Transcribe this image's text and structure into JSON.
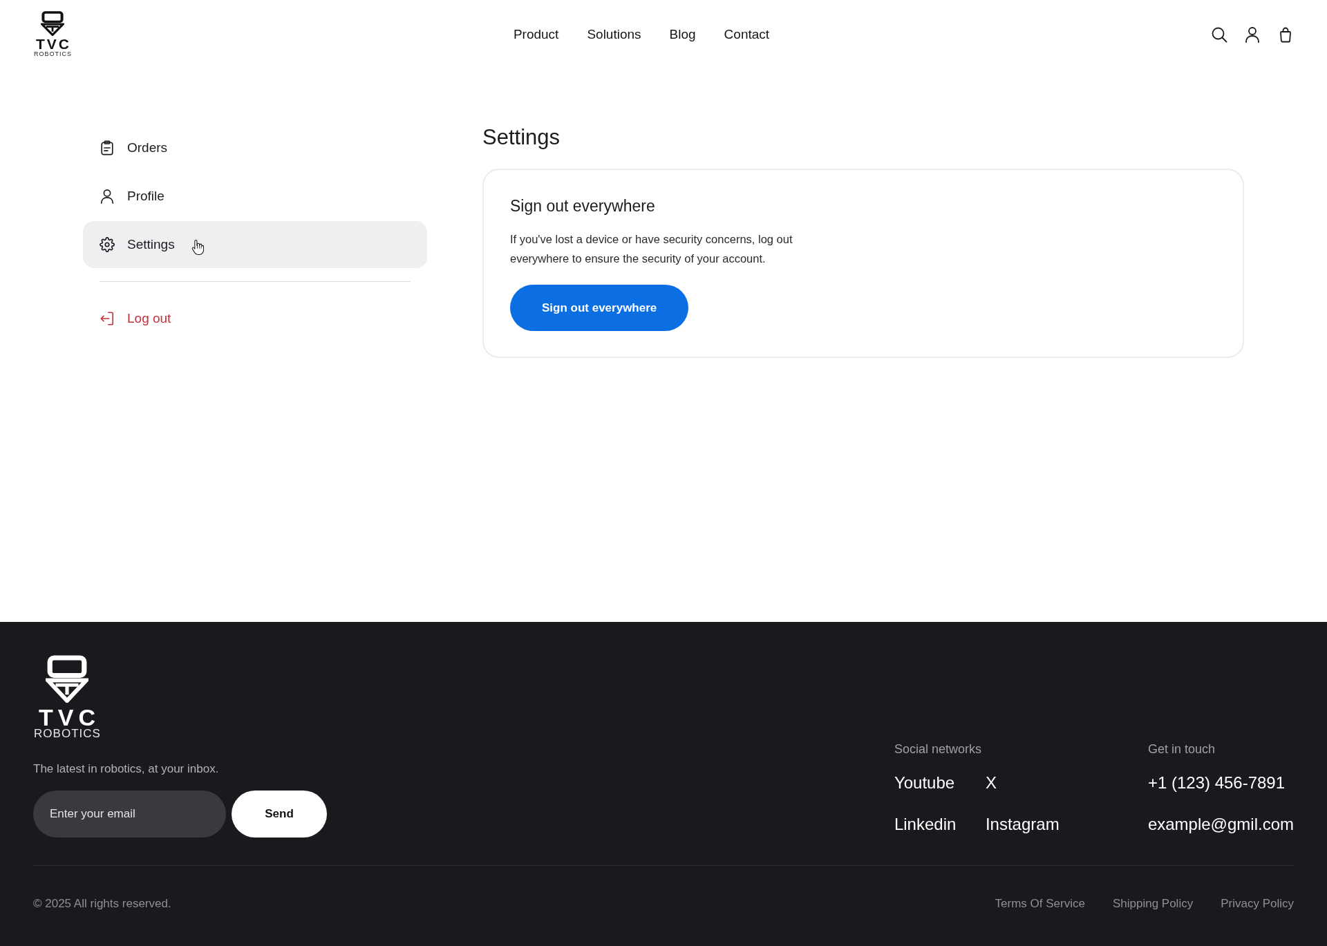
{
  "header": {
    "logo": {
      "name": "TVC",
      "subtitle": "ROBOTICS"
    },
    "nav": [
      "Product",
      "Solutions",
      "Blog",
      "Contact"
    ]
  },
  "sidebar": {
    "items": [
      {
        "label": "Orders",
        "selected": false
      },
      {
        "label": "Profile",
        "selected": false
      },
      {
        "label": "Settings",
        "selected": true
      }
    ],
    "logout": {
      "label": "Log out"
    }
  },
  "page": {
    "title": "Settings",
    "card": {
      "title": "Sign out everywhere",
      "text": "If you've lost a device or have security concerns, log out everywhere to ensure the security of your account.",
      "button": "Sign out everywhere"
    }
  },
  "footer": {
    "logo": {
      "name": "TVC",
      "subtitle": "ROBOTICS"
    },
    "tagline": "The latest in robotics, at your inbox.",
    "newsletter": {
      "placeholder": "Enter your email",
      "button": "Send"
    },
    "social": {
      "heading": "Social networks",
      "links": [
        "Youtube",
        "X",
        "Linkedin",
        "Instagram"
      ]
    },
    "contact": {
      "heading": "Get in touch",
      "phone": "+1 (123) 456-7891",
      "email": "example@gmil.com"
    },
    "copyright": "© 2025 All rights reserved.",
    "legal_links": [
      "Terms Of Service",
      "Shipping Policy",
      "Privacy Policy"
    ]
  }
}
